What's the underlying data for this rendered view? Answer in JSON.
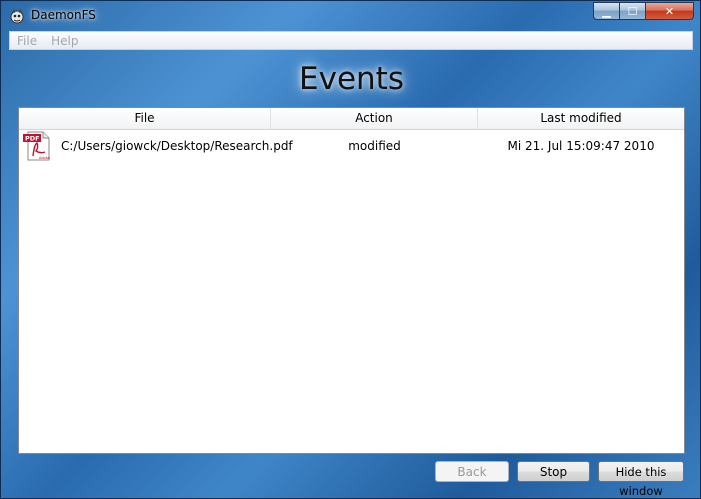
{
  "window": {
    "title": "DaemonFS",
    "controls": {
      "minimize": "▁",
      "maximize": "☐",
      "close": "✕"
    }
  },
  "menu": {
    "items": [
      "File",
      "Help"
    ]
  },
  "heading": "Events",
  "table": {
    "headers": {
      "file": "File",
      "action": "Action",
      "last_modified": "Last modified"
    },
    "rows": [
      {
        "icon": "pdf-file-icon",
        "file": "C:/Users/giowck/Desktop/Research.pdf",
        "action": "modified",
        "last_modified": "Mi 21. Jul 15:09:47 2010"
      }
    ]
  },
  "buttons": {
    "back": "Back",
    "stop": "Stop",
    "hide": "Hide this window"
  },
  "colors": {
    "accent": "#2a6bb0",
    "pdf_red": "#c8102e"
  }
}
